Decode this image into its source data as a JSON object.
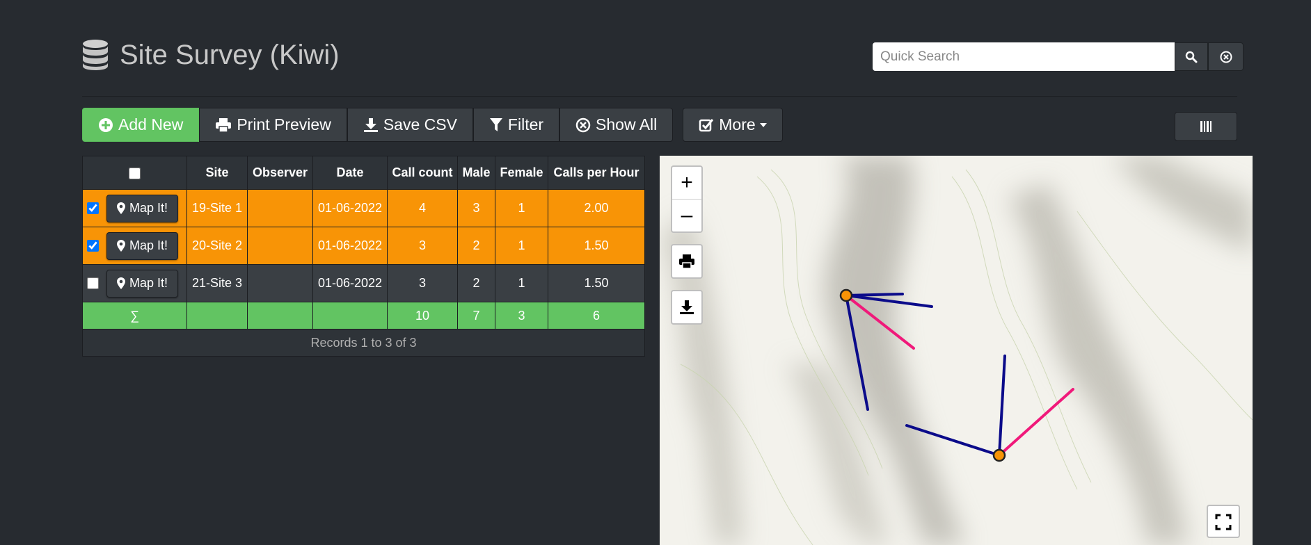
{
  "header": {
    "title": "Site Survey (Kiwi)",
    "icon": "database-icon"
  },
  "search": {
    "placeholder": "Quick Search",
    "value": ""
  },
  "toolbar": {
    "add_new": "Add New",
    "print_preview": "Print Preview",
    "save_csv": "Save CSV",
    "filter": "Filter",
    "show_all": "Show All",
    "more": "More"
  },
  "table": {
    "columns": [
      "Site",
      "Observer",
      "Date",
      "Call count",
      "Male",
      "Female",
      "Calls per Hour"
    ],
    "map_label": "Map It!",
    "rows": [
      {
        "checked": true,
        "site": "19-Site 1",
        "observer": "",
        "date": "01-06-2022",
        "call_count": "4",
        "male": "3",
        "female": "1",
        "calls_per_hour": "2.00"
      },
      {
        "checked": true,
        "site": "20-Site 2",
        "observer": "",
        "date": "01-06-2022",
        "call_count": "3",
        "male": "2",
        "female": "1",
        "calls_per_hour": "1.50"
      },
      {
        "checked": false,
        "site": "21-Site 3",
        "observer": "",
        "date": "01-06-2022",
        "call_count": "3",
        "male": "2",
        "female": "1",
        "calls_per_hour": "1.50"
      }
    ],
    "summary": {
      "symbol": "∑",
      "call_count": "10",
      "male": "7",
      "female": "3",
      "calls_per_hour": "6"
    },
    "footer": "Records 1 to 3 of 3"
  },
  "map": {
    "zoom_in": "+",
    "zoom_out": "–"
  },
  "colors": {
    "selected_row": "#f89406",
    "success": "#62c462",
    "bg": "#272b30",
    "bearing_male": "#0b0b8a",
    "bearing_female": "#f0197a"
  }
}
